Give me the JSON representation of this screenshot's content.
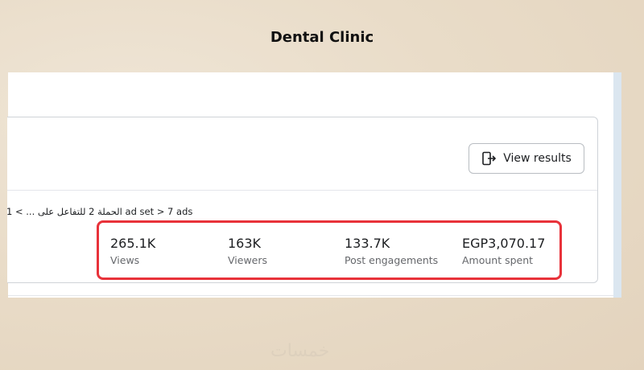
{
  "page_title": "Dental Clinic",
  "toolbar": {
    "view_results_label": "View results"
  },
  "breadcrumb": "الحملة 2 للتفاعل على ... > 1 ad set > 7 ads",
  "metrics": [
    {
      "value": "265.1K",
      "label": "Views"
    },
    {
      "value": "163K",
      "label": "Viewers"
    },
    {
      "value": "133.7K",
      "label": "Post engagements"
    },
    {
      "value": "EGP3,070.17",
      "label": "Amount spent"
    }
  ],
  "watermark": "خمسات",
  "colors": {
    "highlight": "#e8323a",
    "background": "#e9dcc8"
  },
  "icons": {
    "view_results": "view-results-icon"
  }
}
